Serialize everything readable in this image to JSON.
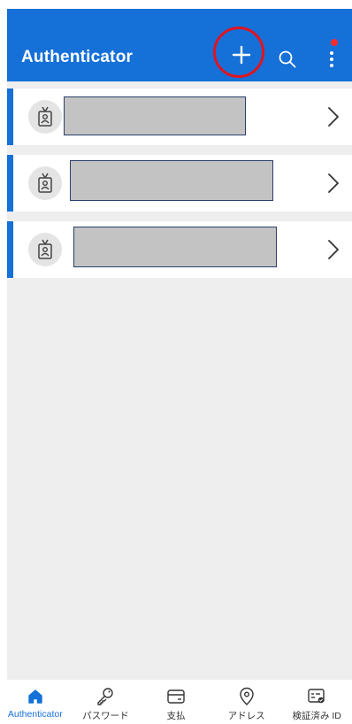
{
  "app_bar": {
    "title": "Authenticator",
    "actions": [
      {
        "name": "add-account",
        "icon": "plus-icon",
        "highlighted": true
      },
      {
        "name": "search",
        "icon": "search-icon"
      },
      {
        "name": "more-options",
        "icon": "more-vertical-icon",
        "notification_dot": true
      }
    ]
  },
  "accounts": [
    {
      "icon": "id-badge-icon",
      "name_redacted": true
    },
    {
      "icon": "id-badge-icon",
      "name_redacted": true
    },
    {
      "icon": "id-badge-icon",
      "name_redacted": true
    }
  ],
  "bottom_nav": [
    {
      "label": "Authenticator",
      "icon": "home-icon",
      "active": true
    },
    {
      "label": "パスワード",
      "icon": "key-icon",
      "active": false
    },
    {
      "label": "支払",
      "icon": "credit-card-icon",
      "active": false
    },
    {
      "label": "アドレス",
      "icon": "location-pin-icon",
      "active": false
    },
    {
      "label": "検証済み ID",
      "icon": "verified-id-icon",
      "active": false
    }
  ],
  "colors": {
    "accent": "#1570d8",
    "highlight_ring": "#e0141e",
    "notification_dot": "#ff2b2b",
    "background": "#eeeeee"
  }
}
